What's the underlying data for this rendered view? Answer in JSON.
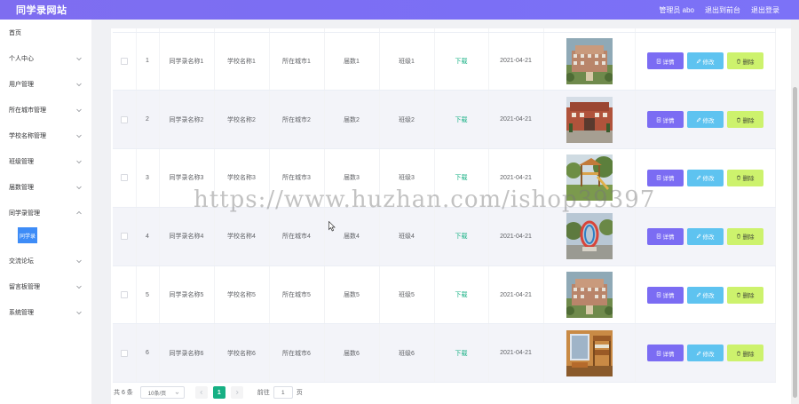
{
  "header": {
    "title": "同学录网站",
    "user": "管理员 abo",
    "back_frontend": "退出到前台",
    "logout": "退出登录"
  },
  "sidebar": {
    "items": [
      {
        "label": "首页",
        "has_arrow": false
      },
      {
        "label": "个人中心",
        "has_arrow": true
      },
      {
        "label": "用户管理",
        "has_arrow": true
      },
      {
        "label": "所在城市管理",
        "has_arrow": true
      },
      {
        "label": "学校名称管理",
        "has_arrow": true
      },
      {
        "label": "班级管理",
        "has_arrow": true
      },
      {
        "label": "届数管理",
        "has_arrow": true
      },
      {
        "label": "同学录管理",
        "has_arrow": true,
        "expanded": true
      },
      {
        "label": "交流论坛",
        "has_arrow": true
      },
      {
        "label": "留言板管理",
        "has_arrow": true
      },
      {
        "label": "系统管理",
        "has_arrow": true
      }
    ],
    "active_sub": "同学录"
  },
  "table": {
    "rows": [
      {
        "index": "1",
        "name": "同学录名称1",
        "school": "学校名称1",
        "city": "所在城市1",
        "session": "届数1",
        "class": "班级1",
        "file": "下载",
        "date": "2021-04-21",
        "image": "building-photo"
      },
      {
        "index": "2",
        "name": "同学录名称2",
        "school": "学校名称2",
        "city": "所在城市2",
        "session": "届数2",
        "class": "班级2",
        "file": "下载",
        "date": "2021-04-21",
        "image": "school-gate-photo"
      },
      {
        "index": "3",
        "name": "同学录名称3",
        "school": "学校名称3",
        "city": "所在城市3",
        "session": "届数3",
        "class": "班级3",
        "file": "下载",
        "date": "2021-04-21",
        "image": "playground-photo"
      },
      {
        "index": "4",
        "name": "同学录名称4",
        "school": "学校名称4",
        "city": "所在城市4",
        "session": "届数4",
        "class": "班级4",
        "file": "下载",
        "date": "2021-04-21",
        "image": "sculpture-photo"
      },
      {
        "index": "5",
        "name": "同学录名称5",
        "school": "学校名称5",
        "city": "所在城市5",
        "session": "届数5",
        "class": "班级5",
        "file": "下载",
        "date": "2021-04-21",
        "image": "building-photo"
      },
      {
        "index": "6",
        "name": "同学录名称6",
        "school": "学校名称6",
        "city": "所在城市6",
        "session": "届数6",
        "class": "班级6",
        "file": "下载",
        "date": "2021-04-21",
        "image": "dorm-photo"
      }
    ],
    "actions": {
      "detail": "详情",
      "edit": "修改",
      "delete": "删除"
    }
  },
  "pagination": {
    "total": "共 6 条",
    "page_size": "10条/页",
    "current_page": "1",
    "goto_label": "前往",
    "goto_value": "1",
    "page_unit": "页"
  },
  "watermark": "https://www.huzhan.com/ishop39397",
  "colors": {
    "header": "#7b6ff5",
    "detail_button": "#7b6cf3",
    "edit_button": "#5ec3f0",
    "delete_button": "#cdf26d",
    "active_page": "#17b084",
    "download_link": "#17b084"
  }
}
